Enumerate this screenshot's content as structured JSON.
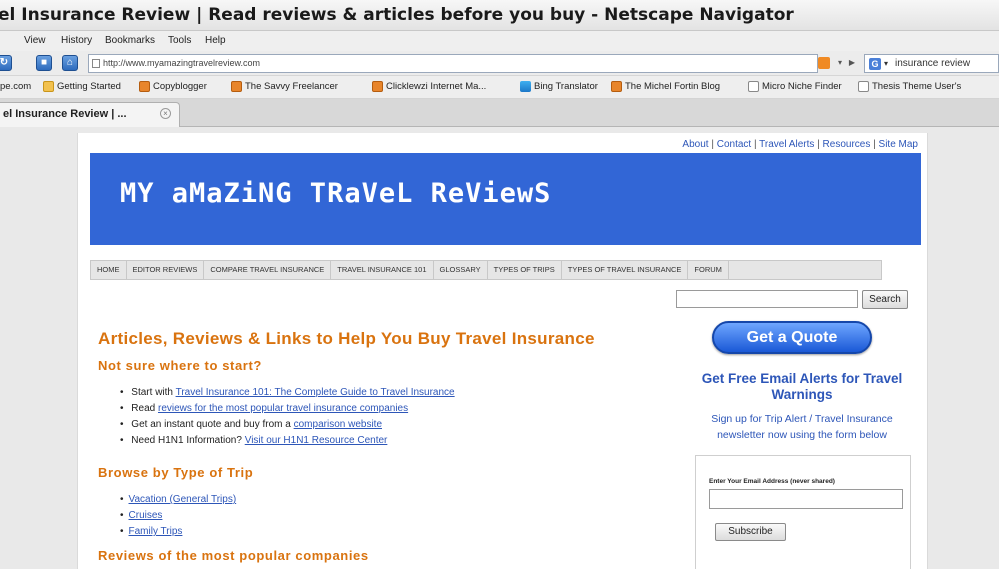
{
  "window": {
    "title": "el Insurance Review | Read reviews & articles before you buy - Netscape Navigator"
  },
  "menu": [
    "View",
    "History",
    "Bookmarks",
    "Tools",
    "Help"
  ],
  "navbar": {
    "url": "http://www.myamazingtravelreview.com",
    "search_value": "insurance review"
  },
  "bookmarks": [
    {
      "label": "pe.com",
      "icon": "none"
    },
    {
      "label": "Getting Started",
      "icon": "folder-icon"
    },
    {
      "label": "Copyblogger",
      "icon": "feed-icon"
    },
    {
      "label": "The Savvy Freelancer",
      "icon": "feed-icon"
    },
    {
      "label": "Clicklewzi Internet Ma...",
      "icon": "feed-icon"
    },
    {
      "label": "Bing Translator",
      "icon": "bing-icon"
    },
    {
      "label": "The Michel Fortin Blog",
      "icon": "feed-icon"
    },
    {
      "label": "Micro Niche Finder",
      "icon": "page-icon"
    },
    {
      "label": "Thesis Theme User's",
      "icon": "page-icon"
    }
  ],
  "tab": {
    "label": "el Insurance Review | ..."
  },
  "site": {
    "top_links": [
      "About",
      "Contact",
      "Travel Alerts",
      "Resources",
      "Site Map"
    ],
    "banner_title": "MY aMaZiNG TRaVeL ReViewS",
    "nav_items": [
      "HOME",
      "EDITOR REVIEWS",
      "COMPARE TRAVEL INSURANCE",
      "TRAVEL INSURANCE 101",
      "GLOSSARY",
      "TYPES OF TRIPS",
      "TYPES OF TRAVEL INSURANCE",
      "FORUM"
    ],
    "search_button": "Search",
    "heading": "Articles, Reviews & Links to Help You Buy Travel Insurance",
    "section1": {
      "title": "Not sure where to start?",
      "items": [
        {
          "before": "Start with ",
          "link": "Travel Insurance 101: The Complete Guide to Travel Insurance",
          "after": ""
        },
        {
          "before": "Read ",
          "link": "reviews for the most popular travel insurance companies",
          "after": ""
        },
        {
          "before": "Get an instant quote and buy from a ",
          "link": "comparison website",
          "after": ""
        },
        {
          "before": "Need H1N1 Information? ",
          "link": "Visit our H1N1 Resource Center",
          "after": ""
        }
      ]
    },
    "section2": {
      "title": "Browse by Type of Trip",
      "items": [
        "Vacation (General Trips)",
        "Cruises",
        "Family Trips"
      ]
    },
    "section3": {
      "title": "Reviews of the most popular companies"
    },
    "sidebar": {
      "quote_button": "Get a Quote",
      "alerts_title": "Get Free Email Alerts for Travel Warnings",
      "alerts_sub": "Sign up for Trip Alert / Travel Insurance newsletter now using the form below",
      "email_label": "Enter Your Email Address (never shared)",
      "subscribe_button": "Subscribe"
    }
  },
  "colors": {
    "banner_bg": "#3266d6",
    "heading_orange": "#d9730f",
    "link_blue": "#2d56b8"
  }
}
